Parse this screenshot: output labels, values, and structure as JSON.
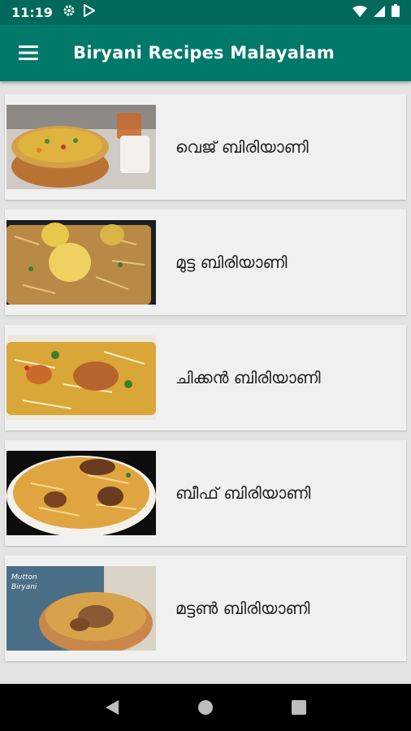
{
  "status_bar": {
    "time": "11:19",
    "icons": [
      "gear-icon",
      "play-store-icon",
      "wifi-icon",
      "signal-icon",
      "battery-icon"
    ]
  },
  "app_bar": {
    "title": "Biryani Recipes Malayalam",
    "menu_icon": "hamburger-menu-icon"
  },
  "recipes": [
    {
      "label": "വെജ് ബിരിയാണി",
      "thumb": "veg-biryani-photo"
    },
    {
      "label": "മുട്ട ബിരിയാണി",
      "thumb": "egg-biryani-photo"
    },
    {
      "label": "ചിക്കൻ ബിരിയാണി",
      "thumb": "chicken-biryani-photo"
    },
    {
      "label": "ബീഫ് ബിരിയാണി",
      "thumb": "beef-biryani-photo"
    },
    {
      "label": "മട്ടൺ ബിരിയാണി",
      "thumb": "mutton-biryani-photo",
      "thumb_text": "Mutton Biryani"
    }
  ],
  "nav_bar": {
    "icons": [
      "back-icon",
      "home-icon",
      "recents-icon"
    ]
  },
  "colors": {
    "status_bar": "#00695c",
    "app_bar": "#00796b",
    "card": "#f0f0f0",
    "background": "#e3e3e3"
  }
}
